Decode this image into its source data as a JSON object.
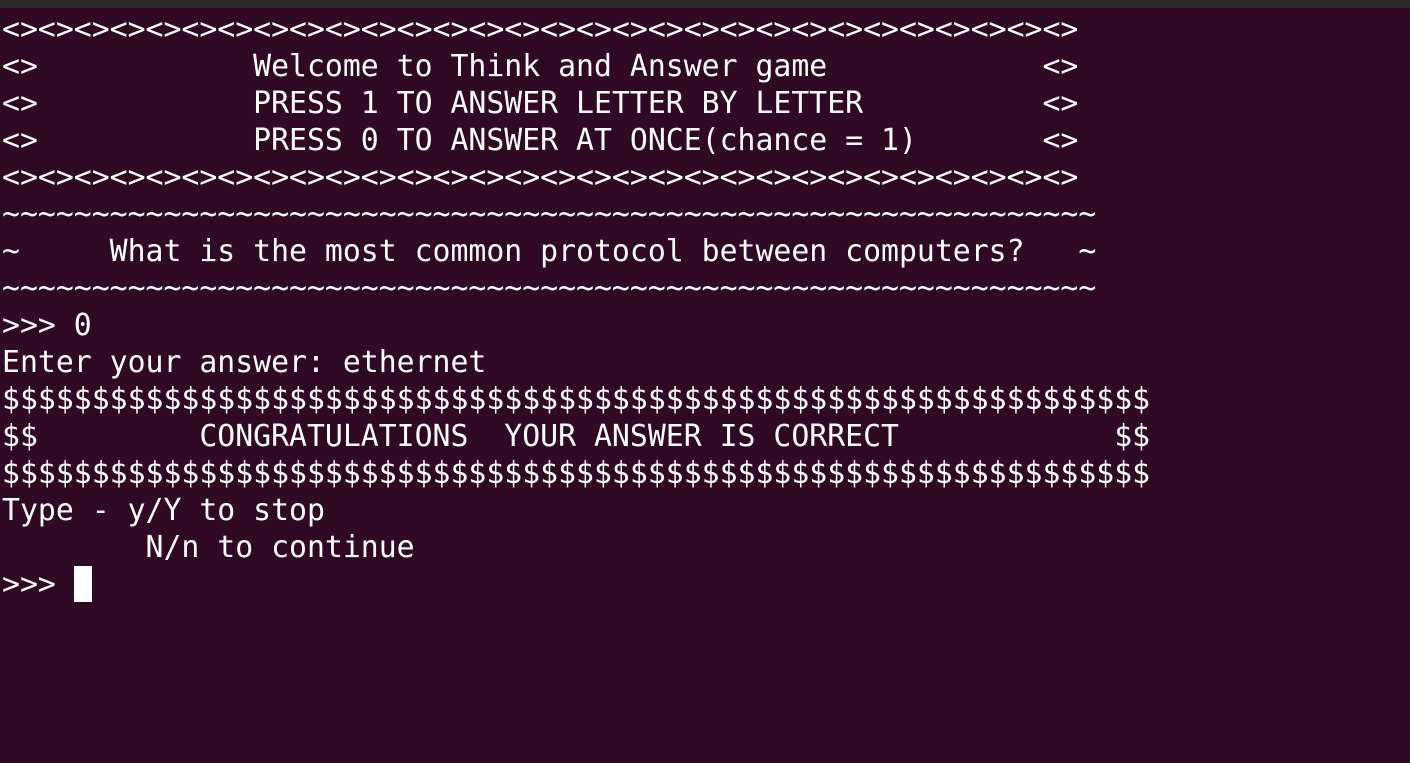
{
  "terminal": {
    "colors": {
      "background": "#300a24",
      "foreground": "#ffffff",
      "titlebar": "#2b2b2b"
    },
    "lines": [
      "<><><><><><><><><><><><><><><><><><><><><><><><><><><><><><>",
      "<>            Welcome to Think and Answer game            <>",
      "<>            PRESS 1 TO ANSWER LETTER BY LETTER          <>",
      "<>            PRESS 0 TO ANSWER AT ONCE(chance = 1)       <>",
      "<><><><><><><><><><><><><><><><><><><><><><><><><><><><><><>",
      "~~~~~~~~~~~~~~~~~~~~~~~~~~~~~~~~~~~~~~~~~~~~~~~~~~~~~~~~~~~~~",
      "~     What is the most common protocol between computers?   ~",
      "~~~~~~~~~~~~~~~~~~~~~~~~~~~~~~~~~~~~~~~~~~~~~~~~~~~~~~~~~~~~~",
      ">>> 0",
      "Enter your answer: ethernet",
      "$$$$$$$$$$$$$$$$$$$$$$$$$$$$$$$$$$$$$$$$$$$$$$$$$$$$$$$$$$$$$$$$",
      "$$         CONGRATULATIONS  YOUR ANSWER IS CORRECT            $$",
      "$$$$$$$$$$$$$$$$$$$$$$$$$$$$$$$$$$$$$$$$$$$$$$$$$$$$$$$$$$$$$$$$",
      "Type - y/Y to stop",
      "        N/n to continue"
    ],
    "prompt": ">>> "
  }
}
